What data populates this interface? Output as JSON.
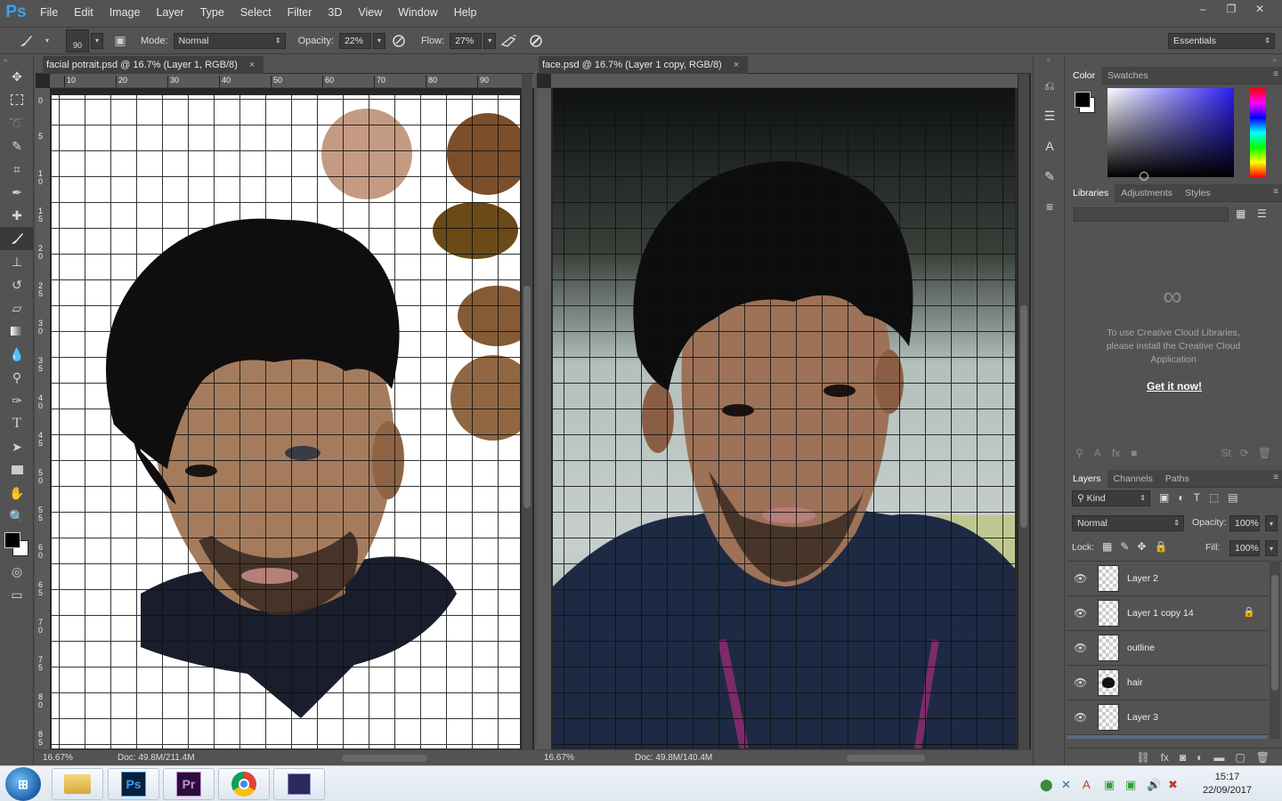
{
  "menubar": {
    "logo": "Ps",
    "items": [
      "File",
      "Edit",
      "Image",
      "Layer",
      "Type",
      "Select",
      "Filter",
      "3D",
      "View",
      "Window",
      "Help"
    ],
    "window_controls": [
      "‒",
      "❐",
      "✕"
    ]
  },
  "options": {
    "brush_size": "90",
    "mode_label": "Mode:",
    "mode_value": "Normal",
    "opacity_label": "Opacity:",
    "opacity_value": "22%",
    "flow_label": "Flow:",
    "flow_value": "27%",
    "workspace": "Essentials"
  },
  "doc_left": {
    "tab_title": "facial potrait.psd @ 16.7% (Layer 1, RGB/8)",
    "close": "×",
    "zoom": "16.67%",
    "docsize": "Doc: 49.8M/211.4M",
    "ruler_h": [
      "10",
      "20",
      "30",
      "40",
      "50",
      "60",
      "70",
      "80",
      "90"
    ],
    "ruler_v": [
      "0",
      "5",
      "10",
      "15",
      "20",
      "25",
      "30",
      "35",
      "40",
      "45",
      "50",
      "55",
      "60",
      "65",
      "70",
      "75",
      "80",
      "85"
    ]
  },
  "doc_right": {
    "tab_title": "face.psd @ 16.7% (Layer 1 copy, RGB/8)",
    "close": "×",
    "zoom": "16.67%",
    "docsize": "Doc: 49.8M/140.4M"
  },
  "color_panel": {
    "tabs": [
      "Color",
      "Swatches"
    ],
    "foreground": "#000000",
    "background": "#ffffff",
    "hue": "#2a1df0"
  },
  "libraries_panel": {
    "tabs": [
      "Libraries",
      "Adjustments",
      "Styles"
    ],
    "message": "To use Creative Cloud Libraries, please install the Creative Cloud Application",
    "link": "Get it now!"
  },
  "layers_panel": {
    "tabs": [
      "Layers",
      "Channels",
      "Paths"
    ],
    "filter_kind": "Kind",
    "blend_mode": "Normal",
    "opacity_label": "Opacity:",
    "opacity_value": "100%",
    "lock_label": "Lock:",
    "fill_label": "Fill:",
    "fill_value": "100%",
    "layers": [
      {
        "name": "Layer 2",
        "locked": false
      },
      {
        "name": "Layer 1 copy 14",
        "locked": true
      },
      {
        "name": "outline",
        "locked": false
      },
      {
        "name": "hair",
        "locked": false
      },
      {
        "name": "Layer 3",
        "locked": false
      }
    ]
  },
  "taskbar": {
    "apps": [
      "explorer",
      "Ps",
      "Pr",
      "chrome",
      "media"
    ],
    "time": "15:17",
    "date": "22/09/2017"
  }
}
